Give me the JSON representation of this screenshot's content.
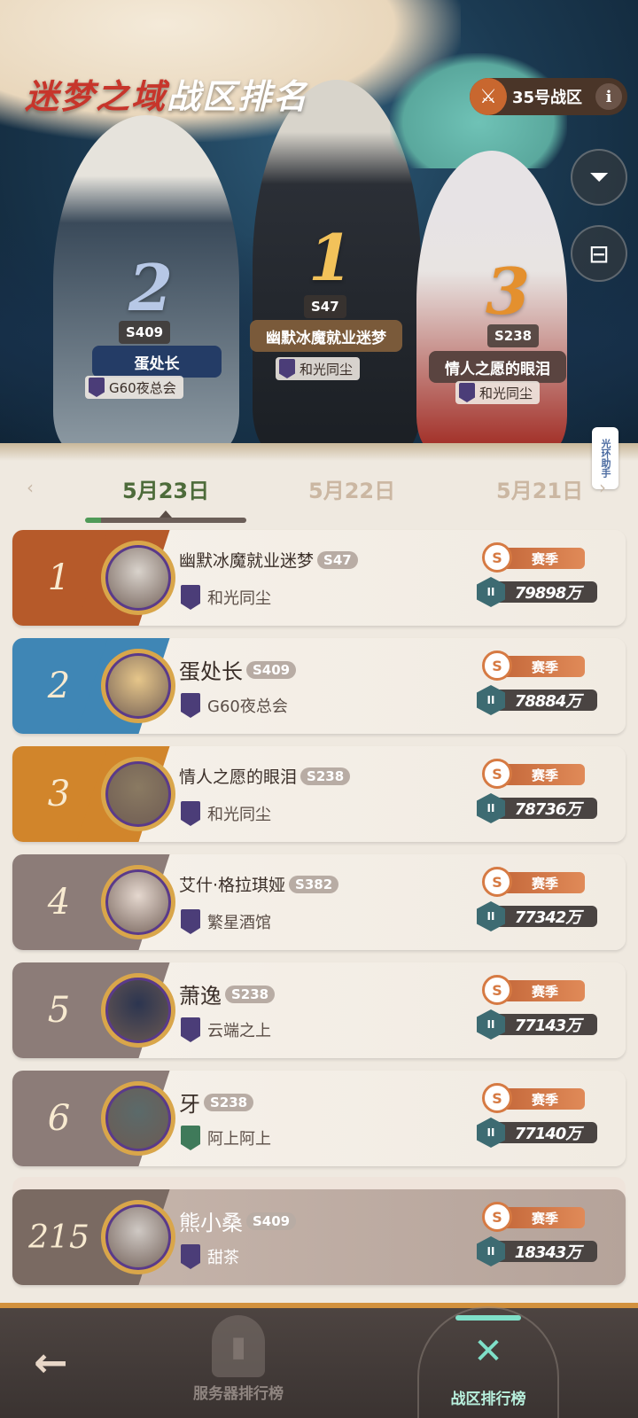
{
  "header": {
    "title_part1": "迷梦之域",
    "title_part2": "战区排名",
    "zone_label": "35号战区",
    "info_icon": "i",
    "swords_icon": "crossed-swords-icon",
    "filter_icon": "filter-icon",
    "chest_icon": "chest-icon"
  },
  "podium": [
    {
      "rank": "1",
      "server": "S47",
      "name": "幽默冰魔就业迷梦",
      "guild": "和光同尘"
    },
    {
      "rank": "2",
      "server": "S409",
      "name": "蛋处长",
      "guild": "G60夜总会"
    },
    {
      "rank": "3",
      "server": "S238",
      "name": "情人之愿的眼泪",
      "guild": "和光同尘"
    }
  ],
  "assistant_tab": "光环助手",
  "dates": {
    "prev_arrow": "‹",
    "next_arrow": "›",
    "tabs": [
      "5月23日",
      "5月22日",
      "5月21日"
    ],
    "active_index": 0
  },
  "season_label": "赛季",
  "rankings": [
    {
      "rank": "1",
      "name": "幽默冰魔就业迷梦",
      "server": "S47",
      "guild": "和光同尘",
      "score": "79898万",
      "band": "#b65a2a",
      "avatar": "#d9d3cc"
    },
    {
      "rank": "2",
      "name": "蛋处长",
      "server": "S409",
      "guild": "G60夜总会",
      "score": "78884万",
      "band": "#3f86b5",
      "avatar": "#e6c68a"
    },
    {
      "rank": "3",
      "name": "情人之愿的眼泪",
      "server": "S238",
      "guild": "和光同尘",
      "score": "78736万",
      "band": "#d1852b",
      "avatar": "#8a7a62"
    },
    {
      "rank": "4",
      "name": "艾什·格拉琪娅",
      "server": "S382",
      "guild": "繁星酒馆",
      "score": "77342万",
      "band": "#8c7c78",
      "avatar": "#e5d8cf"
    },
    {
      "rank": "5",
      "name": "萧逸",
      "server": "S238",
      "guild": "云端之上",
      "score": "77143万",
      "band": "#8c7c78",
      "avatar": "#2c3550"
    },
    {
      "rank": "6",
      "name": "牙",
      "server": "S238",
      "guild": "阿上阿上",
      "score": "77140万",
      "band": "#8c7c78",
      "avatar": "#5b6a6a"
    }
  ],
  "my_rank": {
    "rank": "215",
    "name": "熊小桑",
    "server": "S409",
    "guild": "甜茶",
    "score": "18343万",
    "avatar": "#cfc9c4"
  },
  "bottom_nav": {
    "back_icon": "back-arrow-icon",
    "server_rank": "服务器排行榜",
    "zone_rank": "战区排行榜"
  }
}
